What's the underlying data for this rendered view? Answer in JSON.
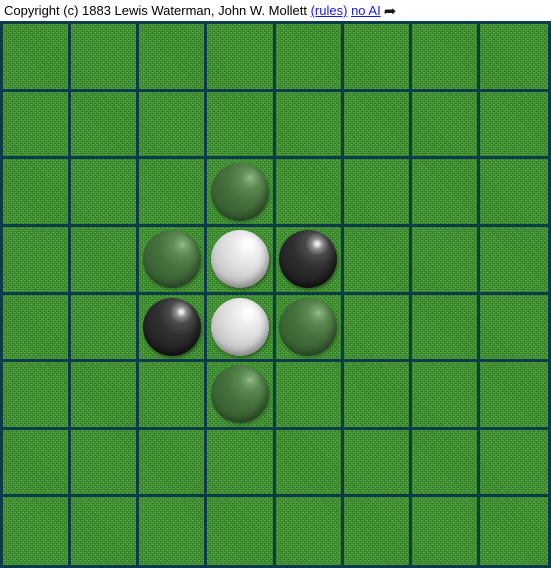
{
  "header": {
    "copyright_text": "Copyright (c) 1883 Lewis Waterman, John W. Mollett",
    "rules_link": "(rules)",
    "no_ai_link": "no AI",
    "share_arrow_icon": "➦",
    "link_color": "#1a1ae6",
    "text_color": "#000000"
  },
  "board": {
    "rows": 8,
    "columns": 8,
    "cell_color": "#3d9b2e",
    "grid_line_color": "#0c3b4a",
    "border_color": "#0c3b4a",
    "piece_colors": {
      "white": "#dcdcdc",
      "black": "#282828",
      "hint": "#3f6b38"
    },
    "legend": {
      "empty": "",
      "white": "white",
      "black": "black",
      "hint": "hint"
    },
    "cells": [
      [
        "",
        "",
        "",
        "",
        "",
        "",
        "",
        ""
      ],
      [
        "",
        "",
        "",
        "",
        "",
        "",
        "",
        ""
      ],
      [
        "",
        "",
        "",
        "hint",
        "",
        "",
        "",
        ""
      ],
      [
        "",
        "",
        "hint",
        "white",
        "black",
        "",
        "",
        ""
      ],
      [
        "",
        "",
        "black",
        "white",
        "hint",
        "",
        "",
        ""
      ],
      [
        "",
        "",
        "",
        "hint",
        "",
        "",
        "",
        ""
      ],
      [
        "",
        "",
        "",
        "",
        "",
        "",
        "",
        ""
      ],
      [
        "",
        "",
        "",
        "",
        "",
        "",
        "",
        ""
      ]
    ],
    "counts": {
      "white": 2,
      "black": 2,
      "hints": 4
    }
  }
}
